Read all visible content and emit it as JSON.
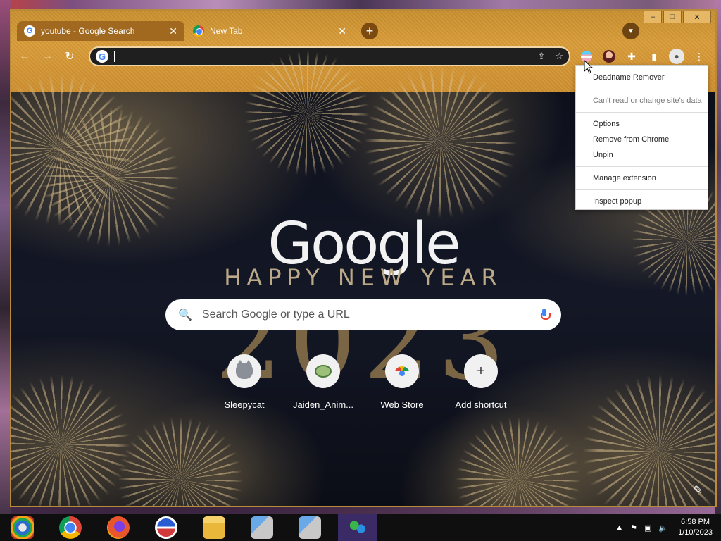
{
  "browser": {
    "tabs": [
      {
        "title": "youtube - Google Search",
        "active": true
      },
      {
        "title": "New Tab",
        "active": false
      }
    ],
    "new_tab_symbol": "+",
    "window_controls": {
      "minimize": "–",
      "maximize": "□",
      "close": "✕"
    },
    "omnibox": {
      "value": "",
      "favicon_letter": "G"
    }
  },
  "extension_menu": {
    "title": "Deadname Remover",
    "items": [
      {
        "label": "Can't read or change site's data",
        "disabled": true
      },
      {
        "label": "Options"
      },
      {
        "label": "Remove from Chrome"
      },
      {
        "label": "Unpin"
      },
      {
        "label": "Manage extension"
      },
      {
        "label": "Inspect popup"
      }
    ]
  },
  "newtab": {
    "logo": "Google",
    "doodle_line": "HAPPY NEW YEAR",
    "doodle_year": "2023",
    "search_placeholder": "Search Google or type a URL",
    "shortcuts": [
      {
        "label": "Sleepycat",
        "icon": "cat-icon"
      },
      {
        "label": "Jaiden_Anim...",
        "icon": "frog-icon"
      },
      {
        "label": "Web Store",
        "icon": "webstore-icon"
      },
      {
        "label": "Add shortcut",
        "icon": "plus-icon"
      }
    ]
  },
  "taskbar": {
    "time": "6:58 PM",
    "date": "1/10/2023"
  },
  "colors": {
    "frame": "#cf9030",
    "active_tab": "#a0691f",
    "taskbar": "#0f0f10"
  }
}
